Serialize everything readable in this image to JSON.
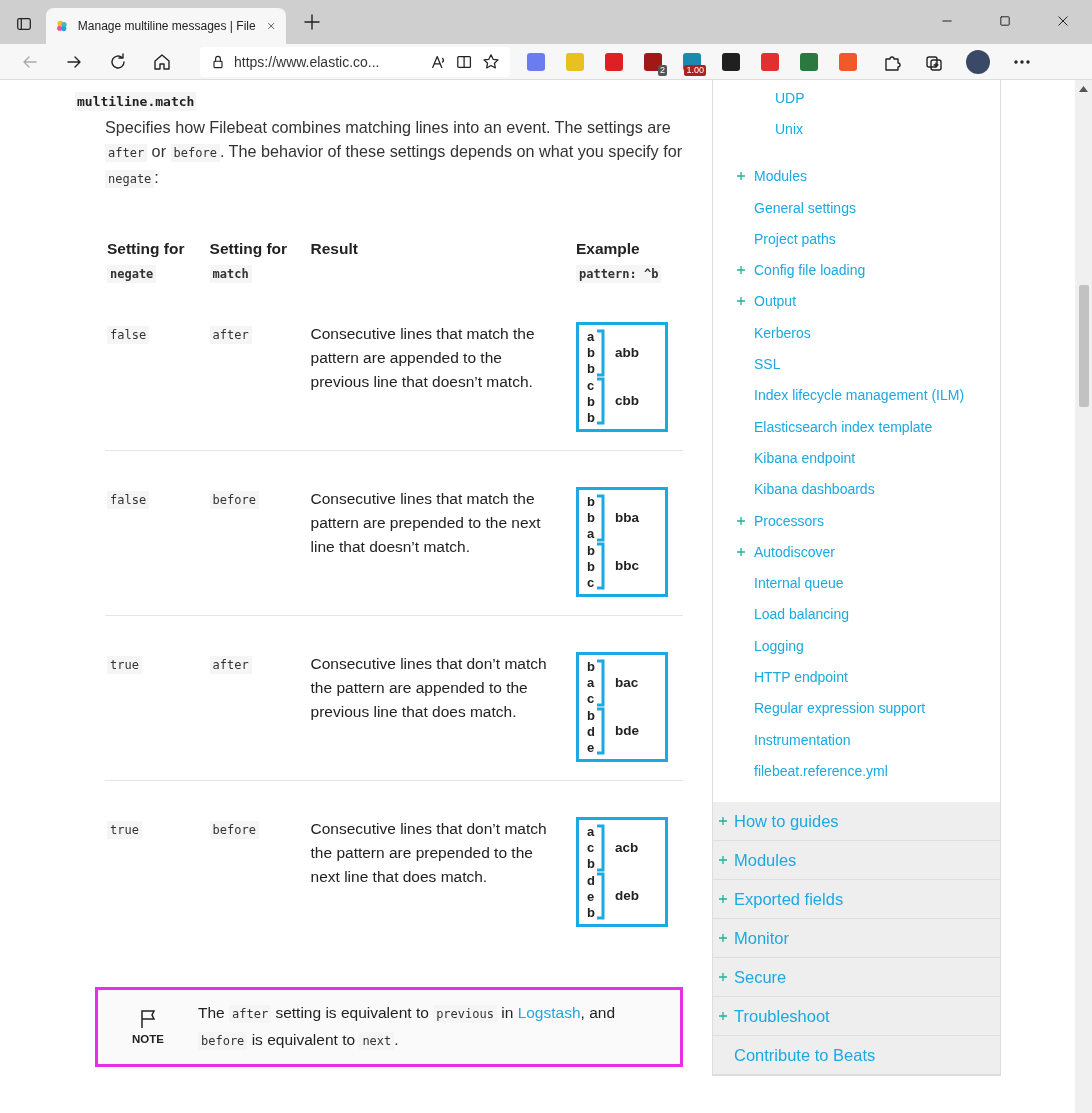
{
  "browser": {
    "tab_title": "Manage multiline messages | File",
    "url": "https://www.elastic.co...",
    "extensions": [
      {
        "color": "#6b7bf0"
      },
      {
        "color": "#e8c020"
      },
      {
        "color": "#e02020"
      },
      {
        "color": "#a01818",
        "badge": "2"
      },
      {
        "color": "#1a8ab0",
        "badge": "1.00"
      },
      {
        "color": "#202020"
      },
      {
        "color": "#e03030"
      },
      {
        "color": "#2a7a40"
      },
      {
        "color": "#f05a28"
      }
    ]
  },
  "setting": {
    "name": "multiline.match",
    "description": [
      {
        "kind": "text",
        "text": "Specifies how Filebeat combines matching lines into an event. The settings are "
      },
      {
        "kind": "code",
        "text": "after"
      },
      {
        "kind": "text",
        "text": " or "
      },
      {
        "kind": "code",
        "text": "before"
      },
      {
        "kind": "text",
        "text": ". The behavior of these settings depends on what you specify for "
      },
      {
        "kind": "code",
        "text": "negate"
      },
      {
        "kind": "text",
        "text": ":"
      }
    ]
  },
  "table": {
    "columns": [
      [
        {
          "kind": "text",
          "text": "Setting for "
        },
        {
          "kind": "code",
          "text": "negate"
        }
      ],
      [
        {
          "kind": "text",
          "text": "Setting for "
        },
        {
          "kind": "code",
          "text": "match"
        }
      ],
      [
        {
          "kind": "text",
          "text": "Result"
        }
      ],
      [
        {
          "kind": "text",
          "text": "Example "
        },
        {
          "kind": "code",
          "text": "pattern: ^b"
        }
      ]
    ],
    "rows": [
      {
        "negate": "false",
        "match": "after",
        "result": "Consecutive lines that match the pattern are appended to the previous line that doesn’t match.",
        "example": {
          "lines": [
            "a",
            "b",
            "b",
            "c",
            "b",
            "b"
          ],
          "groups": [
            "abb",
            "cbb"
          ]
        }
      },
      {
        "negate": "false",
        "match": "before",
        "result": "Consecutive lines that match the pattern are prepended to the next line that doesn’t match.",
        "example": {
          "lines": [
            "b",
            "b",
            "a",
            "b",
            "b",
            "c"
          ],
          "groups": [
            "bba",
            "bbc"
          ]
        }
      },
      {
        "negate": "true",
        "match": "after",
        "result": "Consecutive lines that don’t match the pattern are appended to the previous line that does match.",
        "example": {
          "lines": [
            "b",
            "a",
            "c",
            "b",
            "d",
            "e"
          ],
          "groups": [
            "bac",
            "bde"
          ]
        }
      },
      {
        "negate": "true",
        "match": "before",
        "result": "Consecutive lines that don’t match the pattern are prepended to the next line that does match.",
        "example": {
          "lines": [
            "a",
            "c",
            "b",
            "d",
            "e",
            "b"
          ],
          "groups": [
            "acb",
            "deb"
          ]
        }
      }
    ]
  },
  "note": {
    "label": "NOTE",
    "text": [
      {
        "kind": "text",
        "text": "The "
      },
      {
        "kind": "code",
        "text": "after"
      },
      {
        "kind": "text",
        "text": " setting is equivalent to "
      },
      {
        "kind": "code",
        "text": "previous"
      },
      {
        "kind": "text",
        "text": " in "
      },
      {
        "kind": "link",
        "text": "Logstash"
      },
      {
        "kind": "text",
        "text": ", and "
      },
      {
        "kind": "code",
        "text": "before"
      },
      {
        "kind": "text",
        "text": " is equivalent to "
      },
      {
        "kind": "code",
        "text": "next"
      },
      {
        "kind": "text",
        "text": "."
      }
    ]
  },
  "sidebar": {
    "nested_items": [
      {
        "label": "UDP"
      },
      {
        "label": "Unix"
      }
    ],
    "items": [
      {
        "label": "Modules",
        "expandable": true
      },
      {
        "label": "General settings",
        "expandable": false
      },
      {
        "label": "Project paths",
        "expandable": false
      },
      {
        "label": "Config file loading",
        "expandable": true
      },
      {
        "label": "Output",
        "expandable": true
      },
      {
        "label": "Kerberos",
        "expandable": false
      },
      {
        "label": "SSL",
        "expandable": false
      },
      {
        "label": "Index lifecycle management (ILM)",
        "expandable": false
      },
      {
        "label": "Elasticsearch index template",
        "expandable": false
      },
      {
        "label": "Kibana endpoint",
        "expandable": false
      },
      {
        "label": "Kibana dashboards",
        "expandable": false
      },
      {
        "label": "Processors",
        "expandable": true
      },
      {
        "label": "Autodiscover",
        "expandable": true
      },
      {
        "label": "Internal queue",
        "expandable": false
      },
      {
        "label": "Load balancing",
        "expandable": false
      },
      {
        "label": "Logging",
        "expandable": false
      },
      {
        "label": "HTTP endpoint",
        "expandable": false
      },
      {
        "label": "Regular expression support",
        "expandable": false
      },
      {
        "label": "Instrumentation",
        "expandable": false
      },
      {
        "label": "filebeat.reference.yml",
        "expandable": false
      }
    ],
    "sections": [
      {
        "label": "How to guides",
        "expandable": true
      },
      {
        "label": "Modules",
        "expandable": true
      },
      {
        "label": "Exported fields",
        "expandable": true
      },
      {
        "label": "Monitor",
        "expandable": true
      },
      {
        "label": "Secure",
        "expandable": true
      },
      {
        "label": "Troubleshoot",
        "expandable": true
      },
      {
        "label": "Contribute to Beats",
        "expandable": false
      }
    ]
  }
}
